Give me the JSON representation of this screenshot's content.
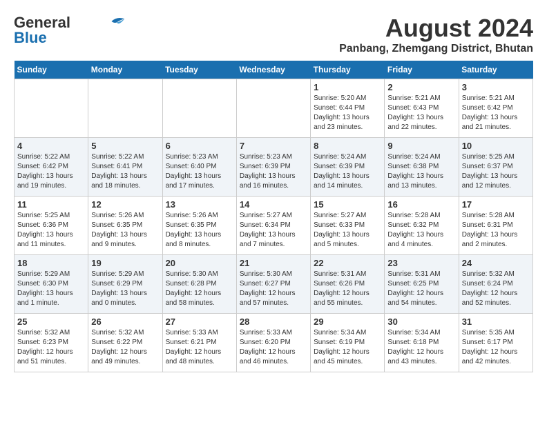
{
  "header": {
    "logo_line1": "General",
    "logo_line2": "Blue",
    "main_title": "August 2024",
    "subtitle": "Panbang, Zhemgang District, Bhutan"
  },
  "weekdays": [
    "Sunday",
    "Monday",
    "Tuesday",
    "Wednesday",
    "Thursday",
    "Friday",
    "Saturday"
  ],
  "weeks": [
    [
      {
        "day": "",
        "info": ""
      },
      {
        "day": "",
        "info": ""
      },
      {
        "day": "",
        "info": ""
      },
      {
        "day": "",
        "info": ""
      },
      {
        "day": "1",
        "info": "Sunrise: 5:20 AM\nSunset: 6:44 PM\nDaylight: 13 hours\nand 23 minutes."
      },
      {
        "day": "2",
        "info": "Sunrise: 5:21 AM\nSunset: 6:43 PM\nDaylight: 13 hours\nand 22 minutes."
      },
      {
        "day": "3",
        "info": "Sunrise: 5:21 AM\nSunset: 6:42 PM\nDaylight: 13 hours\nand 21 minutes."
      }
    ],
    [
      {
        "day": "4",
        "info": "Sunrise: 5:22 AM\nSunset: 6:42 PM\nDaylight: 13 hours\nand 19 minutes."
      },
      {
        "day": "5",
        "info": "Sunrise: 5:22 AM\nSunset: 6:41 PM\nDaylight: 13 hours\nand 18 minutes."
      },
      {
        "day": "6",
        "info": "Sunrise: 5:23 AM\nSunset: 6:40 PM\nDaylight: 13 hours\nand 17 minutes."
      },
      {
        "day": "7",
        "info": "Sunrise: 5:23 AM\nSunset: 6:39 PM\nDaylight: 13 hours\nand 16 minutes."
      },
      {
        "day": "8",
        "info": "Sunrise: 5:24 AM\nSunset: 6:39 PM\nDaylight: 13 hours\nand 14 minutes."
      },
      {
        "day": "9",
        "info": "Sunrise: 5:24 AM\nSunset: 6:38 PM\nDaylight: 13 hours\nand 13 minutes."
      },
      {
        "day": "10",
        "info": "Sunrise: 5:25 AM\nSunset: 6:37 PM\nDaylight: 13 hours\nand 12 minutes."
      }
    ],
    [
      {
        "day": "11",
        "info": "Sunrise: 5:25 AM\nSunset: 6:36 PM\nDaylight: 13 hours\nand 11 minutes."
      },
      {
        "day": "12",
        "info": "Sunrise: 5:26 AM\nSunset: 6:35 PM\nDaylight: 13 hours\nand 9 minutes."
      },
      {
        "day": "13",
        "info": "Sunrise: 5:26 AM\nSunset: 6:35 PM\nDaylight: 13 hours\nand 8 minutes."
      },
      {
        "day": "14",
        "info": "Sunrise: 5:27 AM\nSunset: 6:34 PM\nDaylight: 13 hours\nand 7 minutes."
      },
      {
        "day": "15",
        "info": "Sunrise: 5:27 AM\nSunset: 6:33 PM\nDaylight: 13 hours\nand 5 minutes."
      },
      {
        "day": "16",
        "info": "Sunrise: 5:28 AM\nSunset: 6:32 PM\nDaylight: 13 hours\nand 4 minutes."
      },
      {
        "day": "17",
        "info": "Sunrise: 5:28 AM\nSunset: 6:31 PM\nDaylight: 13 hours\nand 2 minutes."
      }
    ],
    [
      {
        "day": "18",
        "info": "Sunrise: 5:29 AM\nSunset: 6:30 PM\nDaylight: 13 hours\nand 1 minute."
      },
      {
        "day": "19",
        "info": "Sunrise: 5:29 AM\nSunset: 6:29 PM\nDaylight: 13 hours\nand 0 minutes."
      },
      {
        "day": "20",
        "info": "Sunrise: 5:30 AM\nSunset: 6:28 PM\nDaylight: 12 hours\nand 58 minutes."
      },
      {
        "day": "21",
        "info": "Sunrise: 5:30 AM\nSunset: 6:27 PM\nDaylight: 12 hours\nand 57 minutes."
      },
      {
        "day": "22",
        "info": "Sunrise: 5:31 AM\nSunset: 6:26 PM\nDaylight: 12 hours\nand 55 minutes."
      },
      {
        "day": "23",
        "info": "Sunrise: 5:31 AM\nSunset: 6:25 PM\nDaylight: 12 hours\nand 54 minutes."
      },
      {
        "day": "24",
        "info": "Sunrise: 5:32 AM\nSunset: 6:24 PM\nDaylight: 12 hours\nand 52 minutes."
      }
    ],
    [
      {
        "day": "25",
        "info": "Sunrise: 5:32 AM\nSunset: 6:23 PM\nDaylight: 12 hours\nand 51 minutes."
      },
      {
        "day": "26",
        "info": "Sunrise: 5:32 AM\nSunset: 6:22 PM\nDaylight: 12 hours\nand 49 minutes."
      },
      {
        "day": "27",
        "info": "Sunrise: 5:33 AM\nSunset: 6:21 PM\nDaylight: 12 hours\nand 48 minutes."
      },
      {
        "day": "28",
        "info": "Sunrise: 5:33 AM\nSunset: 6:20 PM\nDaylight: 12 hours\nand 46 minutes."
      },
      {
        "day": "29",
        "info": "Sunrise: 5:34 AM\nSunset: 6:19 PM\nDaylight: 12 hours\nand 45 minutes."
      },
      {
        "day": "30",
        "info": "Sunrise: 5:34 AM\nSunset: 6:18 PM\nDaylight: 12 hours\nand 43 minutes."
      },
      {
        "day": "31",
        "info": "Sunrise: 5:35 AM\nSunset: 6:17 PM\nDaylight: 12 hours\nand 42 minutes."
      }
    ]
  ]
}
